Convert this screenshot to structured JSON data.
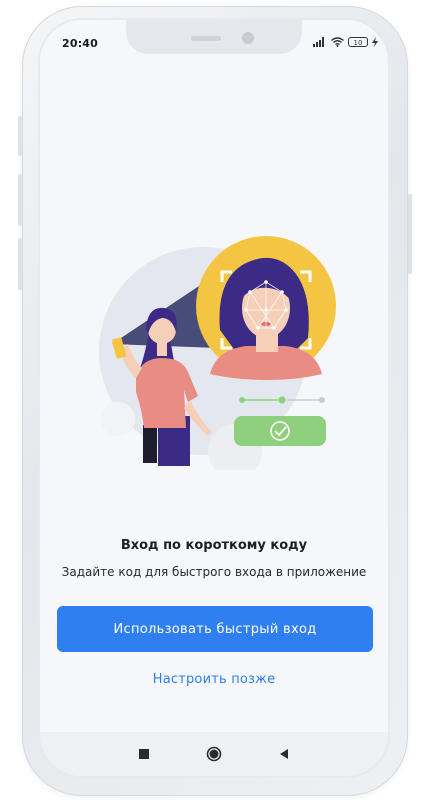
{
  "status_bar": {
    "time": "20:40",
    "battery_level": "10"
  },
  "content": {
    "title": "Вход по короткому коду",
    "subtitle": "Задайте код для быстрого входа в приложение"
  },
  "actions": {
    "primary_label": "Использовать быстрый вход",
    "secondary_label": "Настроить позже"
  },
  "icons": {
    "status": [
      "signal-icon",
      "wifi-icon",
      "battery-icon",
      "charging-icon"
    ],
    "nav": [
      "recent-apps-icon",
      "home-icon",
      "back-icon"
    ]
  },
  "colors": {
    "accent": "#2f7ff1",
    "background": "#f5f7fa",
    "yellow_circle": "#f4c542",
    "confirm_green": "#8fd07e",
    "hair": "#3b2a86",
    "shirt": "#e98c84"
  }
}
